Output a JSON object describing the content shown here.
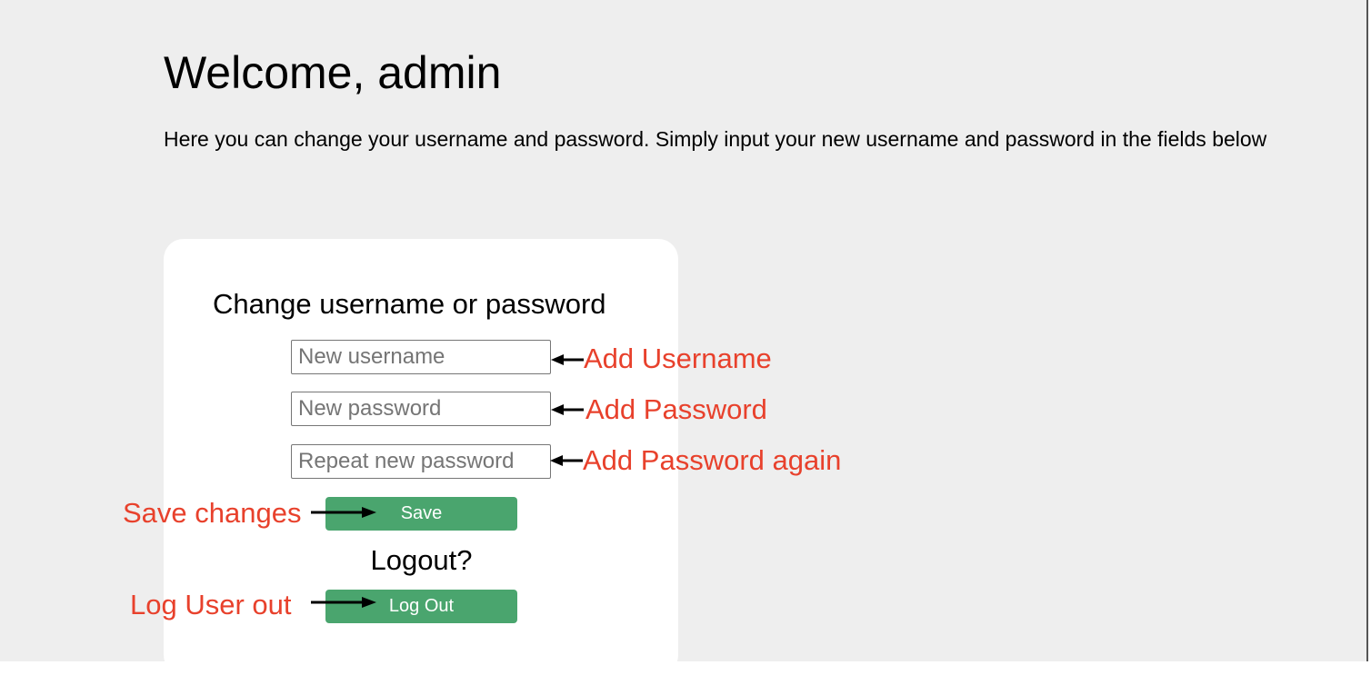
{
  "header": {
    "title": "Welcome, admin",
    "intro": "Here you can change your username and password. Simply input your new username and password in the fields below"
  },
  "form": {
    "title": "Change username or password",
    "username_placeholder": "New username",
    "password_placeholder": "New password",
    "repeat_password_placeholder": "Repeat new password",
    "save_label": "Save",
    "logout_prompt": "Logout?",
    "logout_label": "Log Out"
  },
  "annotations": {
    "add_username": "Add Username",
    "add_password": "Add Password",
    "add_password_again": "Add Password again",
    "save_changes": "Save changes",
    "log_user_out": "Log User out"
  },
  "colors": {
    "background": "#eeeeee",
    "card": "#ffffff",
    "button": "#4aa56e",
    "annotation": "#e8412c"
  }
}
